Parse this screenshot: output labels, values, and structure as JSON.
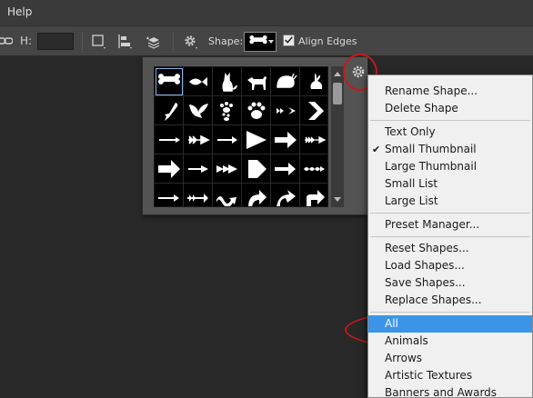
{
  "menubar": {
    "help_label": "Help"
  },
  "options_bar": {
    "h_label": "H:",
    "h_value": "",
    "shape_label": "Shape:",
    "align_edges_label": "Align Edges",
    "align_edges_checked": true
  },
  "shape_picker": {
    "rows": [
      [
        "bone",
        "fish",
        "cat",
        "dog",
        "snail",
        "rabbit"
      ],
      [
        "bird",
        "dove",
        "paw-prints",
        "paw",
        "feather-arrow",
        "chevron-right"
      ],
      [
        "thin-arrow",
        "feather-arrow-2",
        "arrow-right",
        "triangle-arrow",
        "arrow-right-bold",
        "long-feather-arrow"
      ],
      [
        "block-arrow",
        "thin-arrow-2",
        "double-chevron-arrow",
        "pentagon-arrow",
        "arrow-right-2",
        "wavy-arrow"
      ],
      [
        "long-arrow",
        "barb-arrow",
        "squiggle-arrow",
        "curved-arrow",
        "curved-arrow-2",
        "turn-arrow"
      ]
    ],
    "selected": "bone"
  },
  "dropdown": {
    "groups": [
      {
        "items": [
          {
            "label": "Rename Shape..."
          },
          {
            "label": "Delete Shape"
          }
        ]
      },
      {
        "items": [
          {
            "label": "Text Only"
          },
          {
            "label": "Small Thumbnail",
            "checked": true
          },
          {
            "label": "Large Thumbnail"
          },
          {
            "label": "Small List"
          },
          {
            "label": "Large List"
          }
        ]
      },
      {
        "items": [
          {
            "label": "Preset Manager..."
          }
        ]
      },
      {
        "items": [
          {
            "label": "Reset Shapes..."
          },
          {
            "label": "Load Shapes..."
          },
          {
            "label": "Save Shapes..."
          },
          {
            "label": "Replace Shapes..."
          }
        ]
      },
      {
        "items": [
          {
            "label": "All",
            "highlighted": true
          },
          {
            "label": "Animals"
          },
          {
            "label": "Arrows"
          },
          {
            "label": "Artistic Textures"
          },
          {
            "label": "Banners and Awards"
          }
        ]
      }
    ],
    "check_glyph": "✔"
  },
  "colors": {
    "highlight": "#3b94e8",
    "annotation": "#c81818",
    "panel": "#535353",
    "background": "#282828"
  }
}
